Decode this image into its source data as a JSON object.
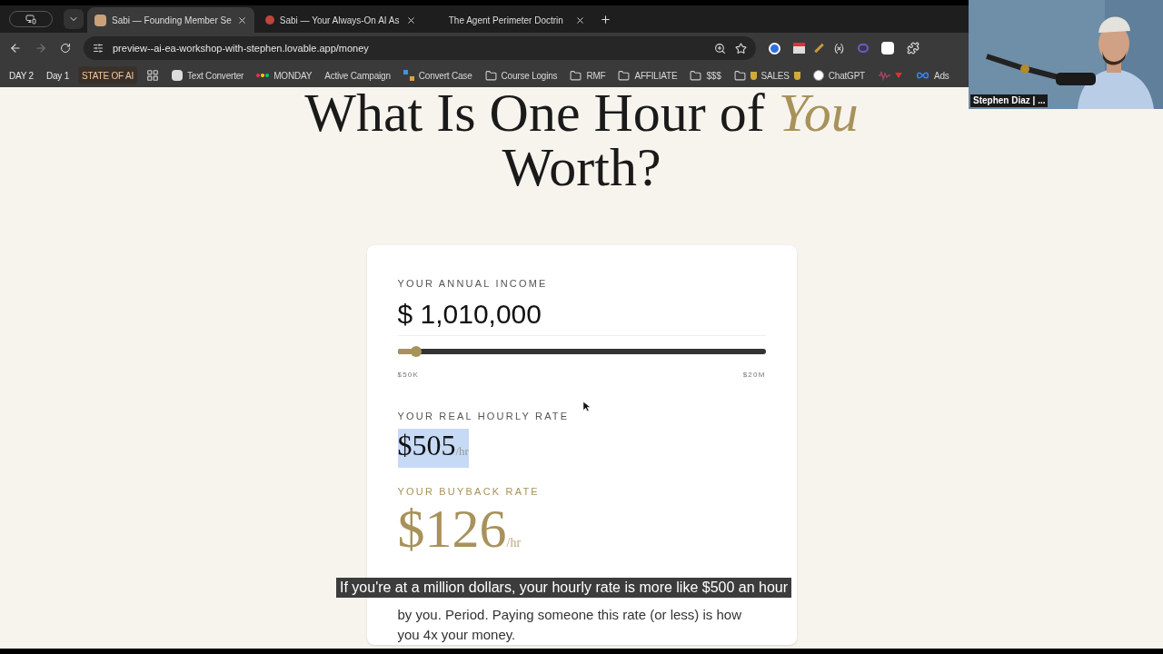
{
  "browser": {
    "tabs": [
      {
        "title": "Sabi — Founding Member Se",
        "selected": true
      },
      {
        "title": "Sabi — Your Always-On AI As",
        "selected": false
      },
      {
        "title": "The Agent Perimeter Doctrin",
        "selected": false
      }
    ],
    "url": "preview--ai-ea-workshop-with-stephen.lovable.app/money",
    "bookmarks": [
      {
        "kind": "pill",
        "label": "DAY 2"
      },
      {
        "kind": "pill",
        "label": "Day 1"
      },
      {
        "kind": "accent",
        "label": "STATE OF AI"
      },
      {
        "kind": "apps"
      },
      {
        "kind": "app",
        "label": "Text Converter"
      },
      {
        "kind": "monday",
        "label": "MONDAY"
      },
      {
        "kind": "plain",
        "label": "Active Campaign"
      },
      {
        "kind": "convert",
        "label": "Convert Case"
      },
      {
        "kind": "folder",
        "label": "Course Logins"
      },
      {
        "kind": "folder",
        "label": "RMF"
      },
      {
        "kind": "folder",
        "label": "AFFILIATE"
      },
      {
        "kind": "folder",
        "label": "$$$"
      },
      {
        "kind": "bags",
        "label": "SALES"
      },
      {
        "kind": "chatgpt",
        "label": "ChatGPT"
      },
      {
        "kind": "wave"
      },
      {
        "kind": "meta",
        "label": "Ads"
      }
    ]
  },
  "page": {
    "title_before": "What Is One Hour of",
    "title_emphasis": "You",
    "title_after": "Worth?",
    "income_label": "YOUR ANNUAL INCOME",
    "income_value": "$ 1,010,000",
    "slider": {
      "level": 0.05,
      "min_label": "$50K",
      "max_label": "$20M"
    },
    "hourly_label": "YOUR REAL HOURLY RATE",
    "hourly_value": "$505",
    "hourly_unit": "/hr",
    "hourly_selected": true,
    "buyback_label": "YOUR BUYBACK RATE",
    "buyback_value": "$126",
    "buyback_unit": "/hr",
    "paragraph": "by you. Period. Paying someone this rate (or less) is how you 4x your money."
  },
  "caption": "If you're at a million dollars, your hourly rate is more like $500 an hour",
  "video": {
    "kind": "picture",
    "name": "Stephen Diaz | ..."
  }
}
